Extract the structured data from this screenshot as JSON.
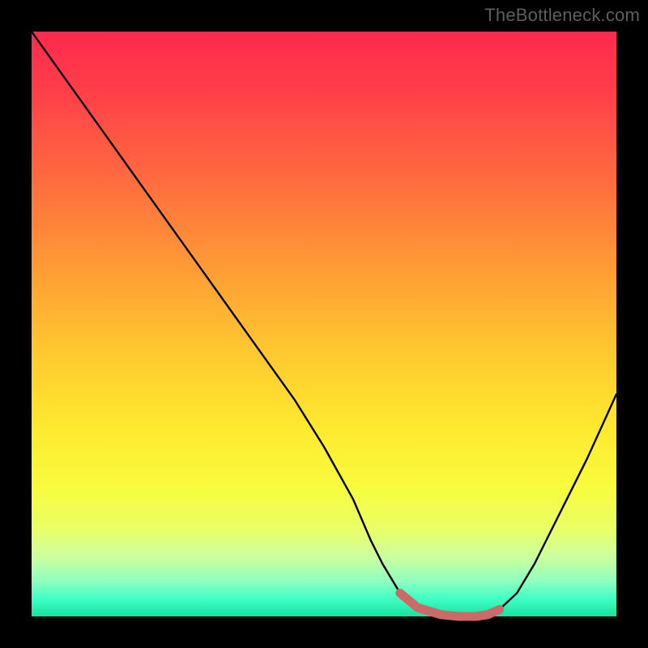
{
  "attribution": "TheBottleneck.com",
  "chart_data": {
    "type": "line",
    "title": "",
    "xlabel": "",
    "ylabel": "",
    "xlim": [
      0,
      100
    ],
    "ylim": [
      0,
      100
    ],
    "series": [
      {
        "name": "bottleneck-curve",
        "x": [
          0,
          5,
          10,
          15,
          20,
          25,
          30,
          35,
          40,
          45,
          50,
          55,
          58,
          60,
          63,
          66,
          70,
          73,
          76,
          78,
          80,
          83,
          86,
          90,
          95,
          100
        ],
        "y": [
          100,
          93,
          86,
          79,
          72,
          65,
          58,
          51,
          44,
          37,
          29,
          20,
          13,
          9,
          4,
          1.5,
          0.3,
          0,
          0,
          0.3,
          1.2,
          4,
          9,
          17,
          27,
          38
        ]
      },
      {
        "name": "highlight-segment",
        "x": [
          63,
          66,
          70,
          73,
          76,
          78,
          80
        ],
        "y": [
          4,
          1.5,
          0.3,
          0,
          0,
          0.3,
          1.2
        ]
      }
    ],
    "colors": {
      "curve": "#000000",
      "highlight": "#cc6a6a",
      "gradient_top": "#ff2a4d",
      "gradient_mid": "#feea2f",
      "gradient_bottom": "#16e29d"
    }
  }
}
